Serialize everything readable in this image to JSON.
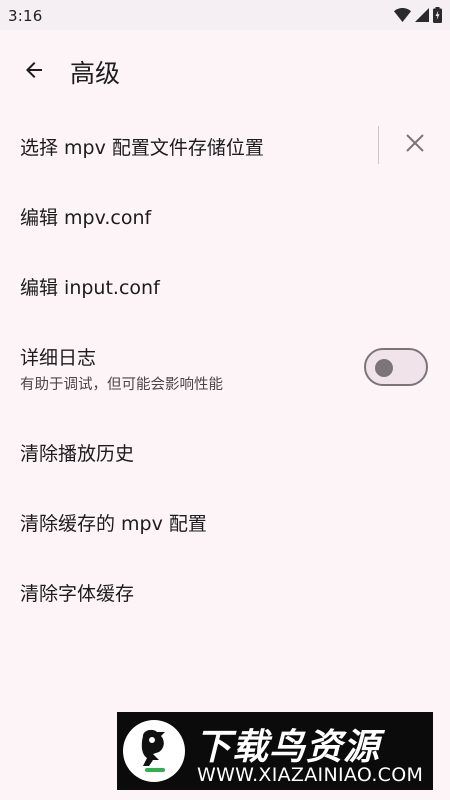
{
  "status_bar": {
    "time": "3:16",
    "icons": [
      "wifi-icon",
      "cellular-signal-icon",
      "battery-charging-icon"
    ]
  },
  "header": {
    "title": "高级",
    "back_icon": "arrow-left-icon"
  },
  "settings": [
    {
      "id": "mpv-config-location",
      "title": "选择 mpv 配置文件存储位置",
      "action_icon": "close-icon"
    },
    {
      "id": "edit-mpv-conf",
      "title": "编辑 mpv.conf"
    },
    {
      "id": "edit-input-conf",
      "title": "编辑 input.conf"
    },
    {
      "id": "verbose-logging",
      "title": "详细日志",
      "subtitle": "有助于调试，但可能会影响性能",
      "toggle": {
        "on": false
      }
    },
    {
      "id": "clear-history",
      "title": "清除播放历史"
    },
    {
      "id": "clear-cached-mpv-config",
      "title": "清除缓存的 mpv 配置"
    },
    {
      "id": "clear-font-cache",
      "title": "清除字体缓存"
    }
  ],
  "watermark": {
    "name": "下载鸟资源",
    "url": "WWW.XIAZAINIAO.COM"
  },
  "colors": {
    "background": "#fdf4f7",
    "switch_outline": "#7d7479",
    "watermark_bg": "#0b0b0b"
  }
}
